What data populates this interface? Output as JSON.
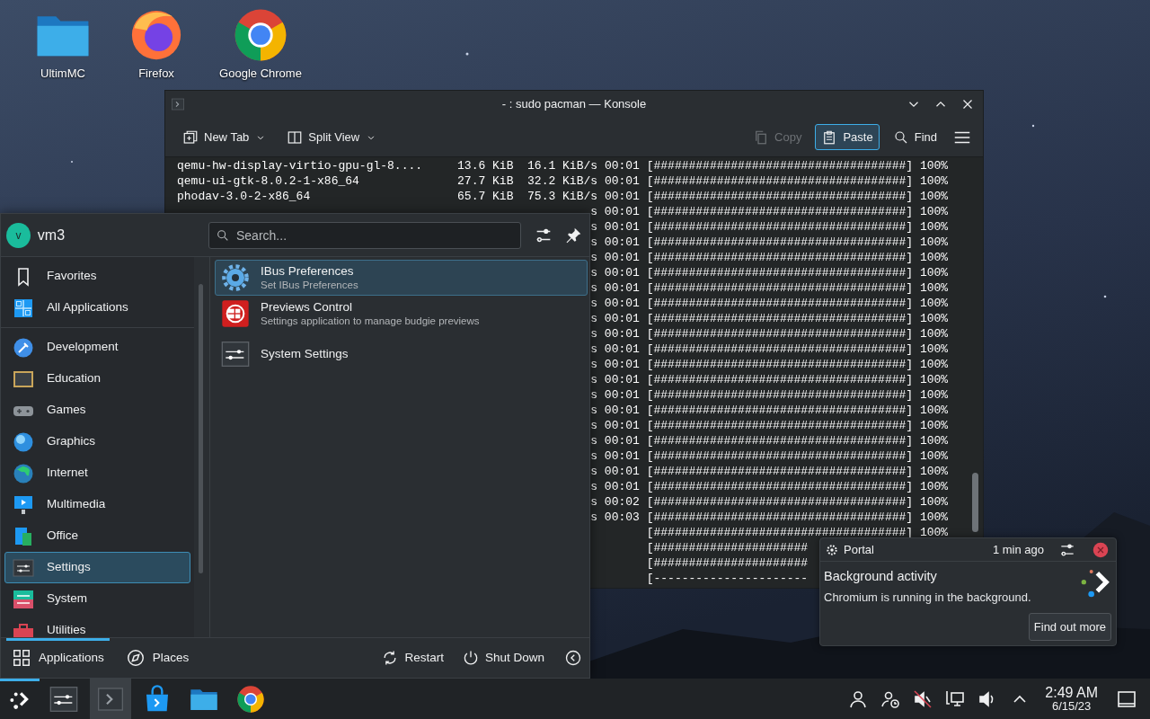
{
  "desktop_icons": [
    {
      "label": "UltimMC"
    },
    {
      "label": "Firefox"
    },
    {
      "label": "Google Chrome"
    }
  ],
  "terminal": {
    "title": "- : sudo pacman — Konsole",
    "toolbar": [
      {
        "label": "New Tab",
        "kind": "new-tab",
        "disabled": false,
        "hovered": false
      },
      {
        "label": "Split View",
        "kind": "split",
        "disabled": false,
        "hovered": false
      },
      {
        "label": "Copy",
        "kind": "copy",
        "disabled": true,
        "hovered": false
      },
      {
        "label": "Paste",
        "kind": "paste",
        "disabled": false,
        "hovered": true
      },
      {
        "label": "Find",
        "kind": "find",
        "disabled": false,
        "hovered": false
      }
    ],
    "lines": [
      {
        "kind": "full",
        "text": "qemu-hw-display-virtio-gpu-gl-8....     13.6 KiB  16.1 KiB/s 00:01 [####################################] 100%"
      },
      {
        "kind": "full",
        "text": "qemu-ui-gtk-8.0.2-1-x86_64              27.7 KiB  32.2 KiB/s 00:01 [####################################] 100%"
      },
      {
        "kind": "full",
        "text": "phodav-3.0-2-x86_64                     65.7 KiB  75.3 KiB/s 00:01 [####################################] 100%"
      },
      {
        "kind": "tail",
        "text": "s 00:01 [####################################] 100%"
      },
      {
        "kind": "tail",
        "text": "s 00:01 [####################################] 100%"
      },
      {
        "kind": "tail",
        "text": "s 00:01 [####################################] 100%"
      },
      {
        "kind": "tail",
        "text": "s 00:01 [####################################] 100%"
      },
      {
        "kind": "tail",
        "text": "s 00:01 [####################################] 100%"
      },
      {
        "kind": "tail",
        "text": "s 00:01 [####################################] 100%"
      },
      {
        "kind": "tail",
        "text": "s 00:01 [####################################] 100%"
      },
      {
        "kind": "tail",
        "text": "s 00:01 [####################################] 100%"
      },
      {
        "kind": "tail",
        "text": "s 00:01 [####################################] 100%"
      },
      {
        "kind": "tail",
        "text": "s 00:01 [####################################] 100%"
      },
      {
        "kind": "tail",
        "text": "s 00:01 [####################################] 100%"
      },
      {
        "kind": "tail",
        "text": "s 00:01 [####################################] 100%"
      },
      {
        "kind": "tail",
        "text": "s 00:01 [####################################] 100%"
      },
      {
        "kind": "tail",
        "text": "s 00:01 [####################################] 100%"
      },
      {
        "kind": "tail",
        "text": "s 00:01 [####################################] 100%"
      },
      {
        "kind": "tail",
        "text": "s 00:01 [####################################] 100%"
      },
      {
        "kind": "tail",
        "text": "s 00:01 [####################################] 100%"
      },
      {
        "kind": "tail",
        "text": "s 00:01 [####################################] 100%"
      },
      {
        "kind": "tail",
        "text": "s 00:01 [####################################] 100%"
      },
      {
        "kind": "tail",
        "text": "s 00:02 [####################################] 100%"
      },
      {
        "kind": "tail",
        "text": "s 00:03 [####################################] 100%"
      },
      {
        "kind": "bar",
        "text": "[####################################] 100%"
      },
      {
        "kind": "bar",
        "text": "[######################"
      },
      {
        "kind": "bar",
        "text": "[######################"
      },
      {
        "kind": "bar",
        "text": "[----------------------"
      }
    ]
  },
  "menu": {
    "user": {
      "initial": "v",
      "name": "vm3"
    },
    "search": {
      "placeholder": "Search..."
    },
    "categories": [
      {
        "label": "Favorites",
        "selected": false
      },
      {
        "label": "All Applications",
        "selected": false
      },
      {
        "label": "Development",
        "selected": false
      },
      {
        "label": "Education",
        "selected": false
      },
      {
        "label": "Games",
        "selected": false
      },
      {
        "label": "Graphics",
        "selected": false
      },
      {
        "label": "Internet",
        "selected": false
      },
      {
        "label": "Multimedia",
        "selected": false
      },
      {
        "label": "Office",
        "selected": false
      },
      {
        "label": "Settings",
        "selected": true
      },
      {
        "label": "System",
        "selected": false
      },
      {
        "label": "Utilities",
        "selected": false
      }
    ],
    "apps": [
      {
        "name": "IBus Preferences",
        "description": "Set IBus Preferences",
        "selected": true
      },
      {
        "name": "Previews Control",
        "description": "Settings application to manage budgie previews",
        "selected": false
      },
      {
        "name": "System Settings",
        "selected": false
      }
    ],
    "tabs": [
      {
        "label": "Applications",
        "selected": true
      },
      {
        "label": "Places",
        "selected": false
      }
    ],
    "actions": [
      {
        "label": "Restart"
      },
      {
        "label": "Shut Down"
      }
    ]
  },
  "notification": {
    "app": "Portal",
    "time": "1 min ago",
    "title": "Background activity",
    "body": "Chromium is running in the background.",
    "button": "Find out more"
  },
  "taskbar": {
    "launcher": {
      "open": true
    },
    "tasks": [
      {
        "active": false
      },
      {
        "active": true
      },
      {
        "active": false
      },
      {
        "active": false
      },
      {
        "active": false
      }
    ],
    "clock": {
      "time": "2:49 AM",
      "date": "6/15/23"
    }
  }
}
